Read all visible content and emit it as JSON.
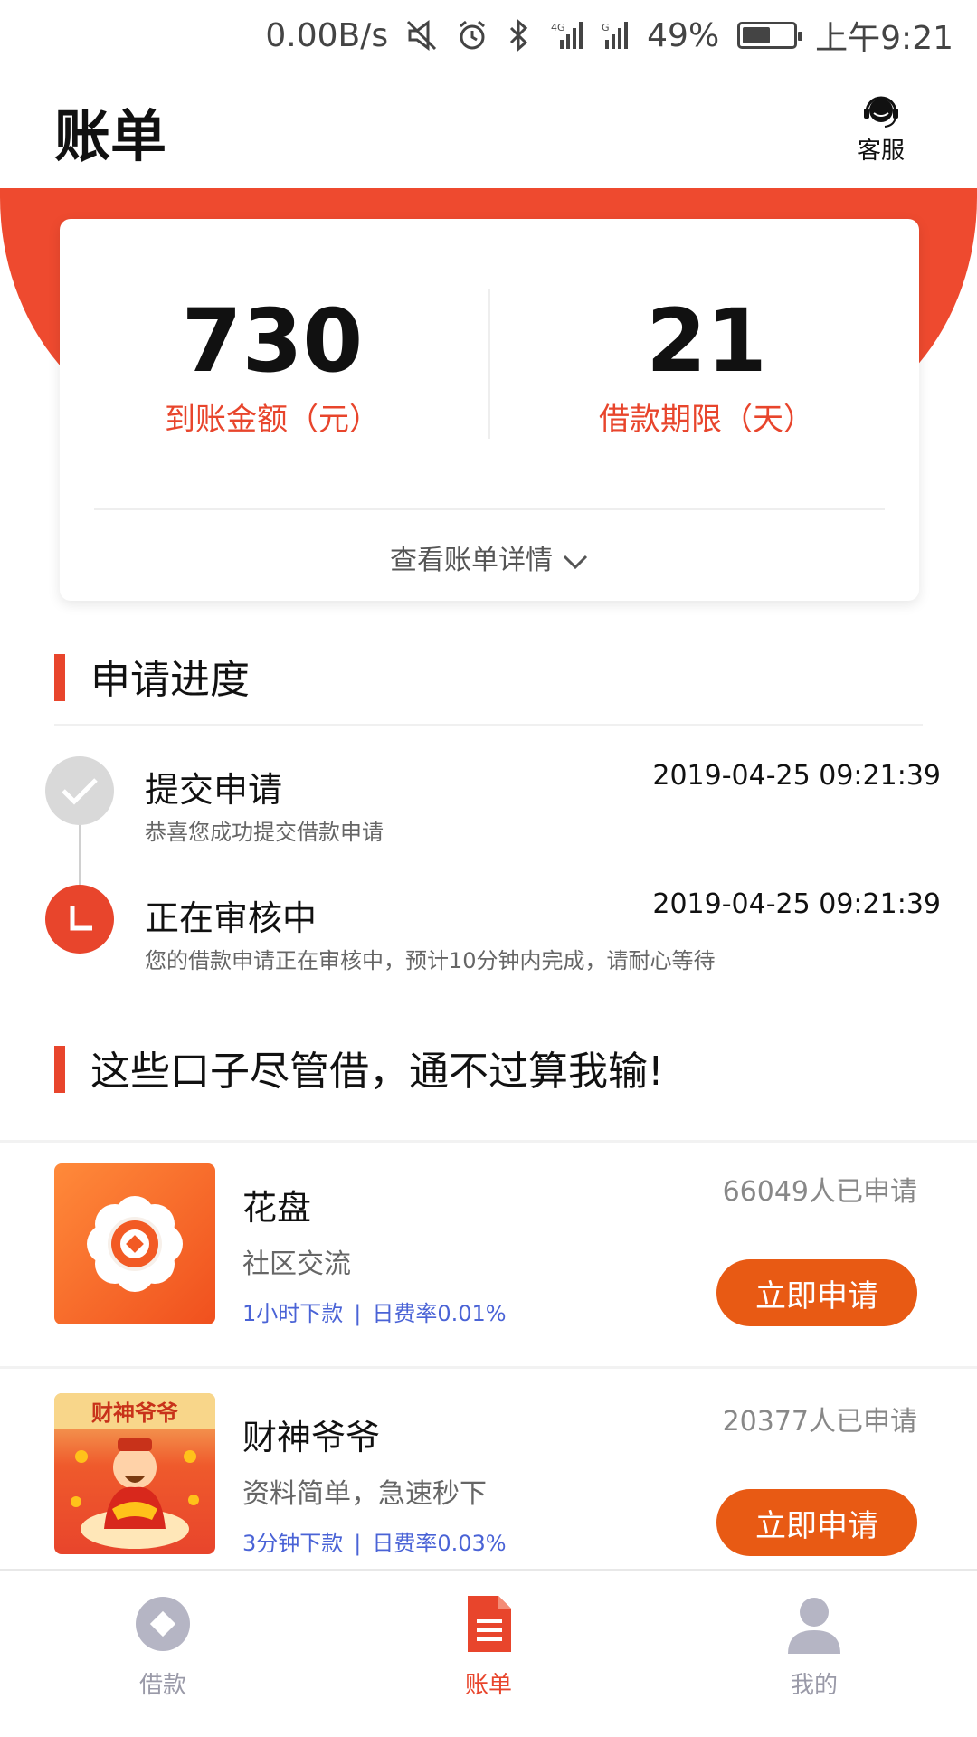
{
  "status_bar": {
    "net_speed": "0.00B/s",
    "battery": "49%",
    "battery_level": 0.49,
    "time": "上午9:21"
  },
  "header": {
    "title": "账单",
    "customer_service": "客服"
  },
  "summary": {
    "amount_value": "730",
    "amount_label": "到账金额（元）",
    "term_value": "21",
    "term_label": "借款期限（天）",
    "detail_link": "查看账单详情"
  },
  "progress": {
    "section_title": "申请进度",
    "steps": [
      {
        "title": "提交申请",
        "desc": "恭喜您成功提交借款申请",
        "time": "2019-04-25 09:21:39",
        "status": "done"
      },
      {
        "title": "正在审核中",
        "desc": "您的借款申请正在审核中，预计10分钟内完成，请耐心等待",
        "time": "2019-04-25 09:21:39",
        "status": "active"
      }
    ]
  },
  "recommend": {
    "section_title": "这些口子尽管借，通不过算我输!",
    "products": [
      {
        "name": "花盘",
        "tagline": "社区交流",
        "feature_1": "1小时下款",
        "separator": "|",
        "feature_2": "日费率0.01%",
        "applied": "66049人已申请",
        "button": "立即申请",
        "logo_icon": "flower-logo-icon"
      },
      {
        "name": "财神爷爷",
        "tagline": "资料简单，急速秒下",
        "feature_1": "3分钟下款",
        "separator": "|",
        "feature_2": "日费率0.03%",
        "applied": "20377人已申请",
        "button": "立即申请",
        "logo_icon": "god-of-wealth-logo-icon",
        "logo_text": "财神爷爷"
      }
    ]
  },
  "bottom_nav": {
    "items": [
      {
        "label": "借款",
        "icon": "diamond-icon",
        "active": false
      },
      {
        "label": "账单",
        "icon": "bill-icon",
        "active": true
      },
      {
        "label": "我的",
        "icon": "user-icon",
        "active": false
      }
    ]
  },
  "colors": {
    "accent": "#e8452c",
    "button": "#e85a14",
    "link_blue": "#4a63d6"
  }
}
